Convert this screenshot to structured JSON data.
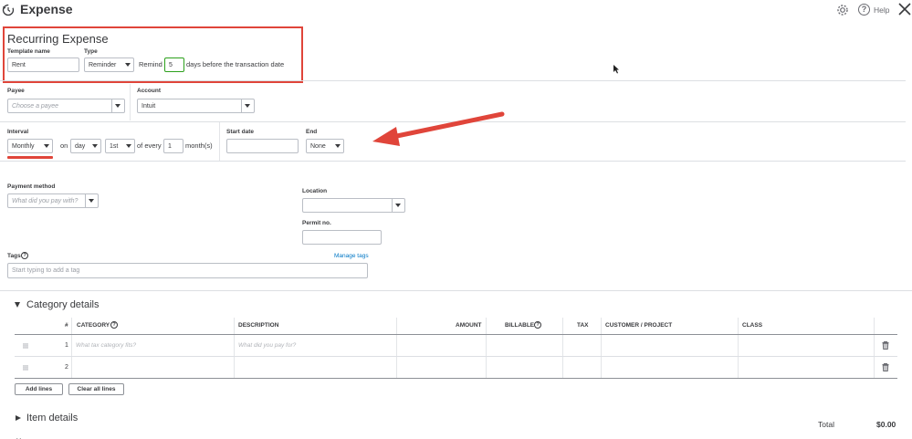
{
  "header": {
    "title": "Expense",
    "help": "Help"
  },
  "recurring": {
    "heading": "Recurring Expense"
  },
  "template": {
    "label": "Template name",
    "value": "Rent"
  },
  "type": {
    "label": "Type",
    "value": "Reminder"
  },
  "remind": {
    "prefix": "Remind",
    "days": "5",
    "suffix": "days before the transaction date"
  },
  "payee": {
    "label": "Payee",
    "placeholder": "Choose a payee"
  },
  "account": {
    "label": "Account",
    "value": "Intuit"
  },
  "interval": {
    "label": "Interval",
    "value": "Monthly",
    "on": "on",
    "unit": "day",
    "day": "1st",
    "of_every": "of every",
    "count": "1",
    "months": "month(s)"
  },
  "start_date": {
    "label": "Start date",
    "value": ""
  },
  "end": {
    "label": "End",
    "value": "None"
  },
  "payment_method": {
    "label": "Payment method",
    "placeholder": "What did you pay with?"
  },
  "location": {
    "label": "Location",
    "value": ""
  },
  "permit": {
    "label": "Permit no.",
    "value": ""
  },
  "tags": {
    "label": "Tags",
    "manage": "Manage tags",
    "placeholder": "Start typing to add a tag"
  },
  "category": {
    "heading": "Category details",
    "columns": {
      "num": "#",
      "category": "CATEGORY",
      "description": "DESCRIPTION",
      "amount": "AMOUNT",
      "billable": "BILLABLE",
      "tax": "TAX",
      "customer": "CUSTOMER / PROJECT",
      "class": "CLASS"
    },
    "rows": [
      {
        "num": "1",
        "category_ph": "What tax category fits?",
        "description_ph": "What did you pay for?"
      },
      {
        "num": "2",
        "category_ph": "",
        "description_ph": ""
      }
    ],
    "add_lines": "Add lines",
    "clear_lines": "Clear all lines"
  },
  "item": {
    "heading": "Item details"
  },
  "total": {
    "label": "Total",
    "value": "$0.00"
  },
  "colors": {
    "annotation_red": "#e0453a",
    "link_blue": "#0077c5",
    "green_focus": "#2ca01c"
  }
}
